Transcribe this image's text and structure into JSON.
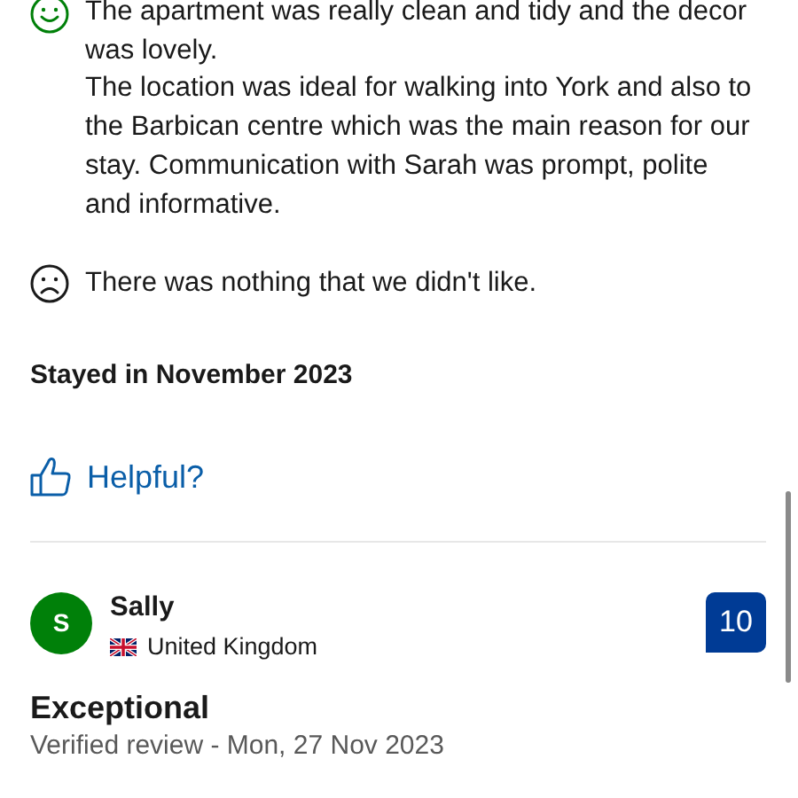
{
  "review_top": {
    "liked": [
      "The apartment was really clean and tidy and the decor was lovely.",
      "The location was ideal for walking into York and also to the Barbican centre which was the main reason for our stay. Communication  with Sarah was prompt, polite and informative."
    ],
    "disliked": "There was nothing that we didn't like.",
    "stay": "Stayed in November 2023",
    "helpful": "Helpful?"
  },
  "review_next": {
    "avatar_letter": "S",
    "name": "Sally",
    "country": "United Kingdom",
    "score": "10",
    "headline": "Exceptional",
    "meta": "Verified review - Mon, 27 Nov 2023"
  }
}
